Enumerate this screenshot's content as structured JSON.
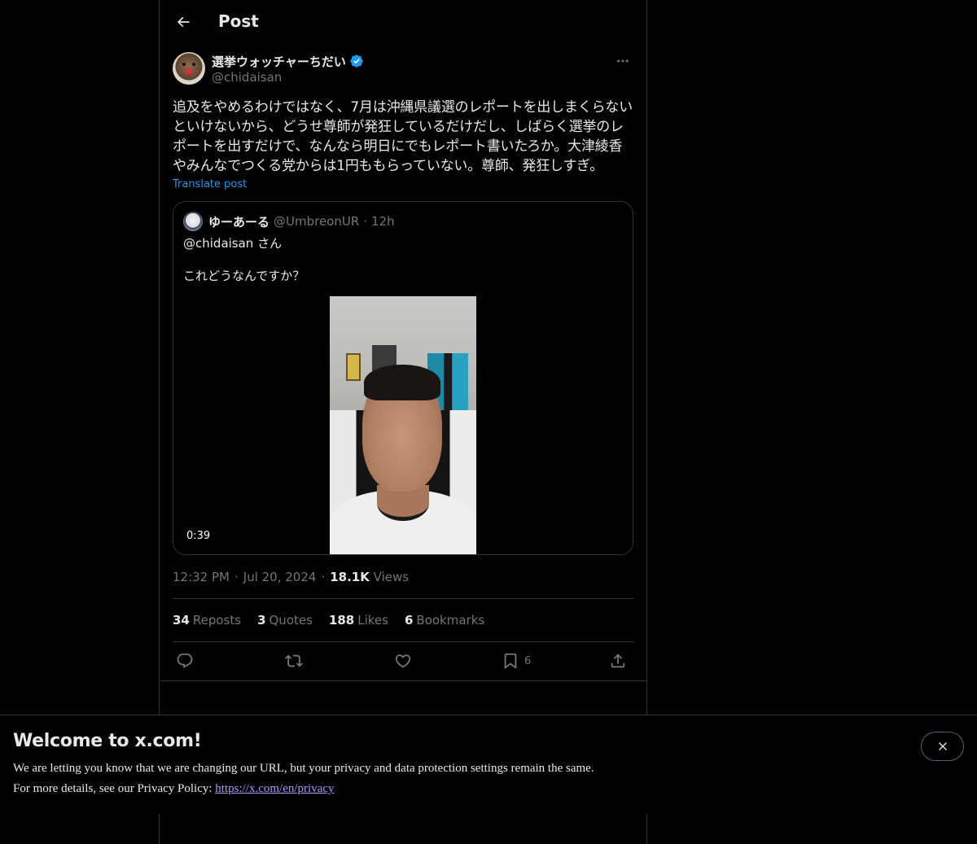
{
  "header": {
    "title": "Post"
  },
  "tweet": {
    "author_name": "選挙ウォッチャーちだい",
    "author_handle": "@chidaisan",
    "text": "追及をやめるわけではなく、7月は沖縄県議選のレポートを出しまくらないといけないから、どうせ尊師が発狂しているだけだし、しばらく選挙のレポートを出すだけで、なんなら明日にでもレポート書いたろか。大津綾香やみんなでつくる党からは1円ももらっていない。尊師、発狂しすぎ。",
    "translate_label": "Translate post",
    "time": "12:32 PM",
    "date": "Jul 20, 2024",
    "views_count": "18.1K",
    "views_label": "Views"
  },
  "quote": {
    "author_name": "ゆーあーる",
    "author_handle": "@UmbreonUR",
    "age": "12h",
    "line1": "@chidaisan さん",
    "line2": "これどうなんですか？",
    "video_duration": "0:39"
  },
  "stats": {
    "reposts_count": "34",
    "reposts_label": "Reposts",
    "quotes_count": "3",
    "quotes_label": "Quotes",
    "likes_count": "188",
    "likes_label": "Likes",
    "bookmarks_count": "6",
    "bookmarks_label": "Bookmarks"
  },
  "actions": {
    "bookmark_count": "6"
  },
  "banner": {
    "title": "Welcome to x.com!",
    "line1": "We are letting you know that we are changing our URL, but your privacy and data protection settings remain the same.",
    "line2_prefix": "For more details, see our Privacy Policy:",
    "link": "https://x.com/en/privacy"
  },
  "colors": {
    "accent": "#1d9bf0",
    "verified": "#1d9bf0",
    "muted": "#71767b",
    "border": "#2f3336",
    "link_banner": "#a59bff"
  },
  "icons": [
    "back-arrow-icon",
    "verified-badge-icon",
    "more-icon",
    "reply-icon",
    "repost-icon",
    "like-icon",
    "bookmark-icon",
    "share-icon",
    "close-icon"
  ]
}
